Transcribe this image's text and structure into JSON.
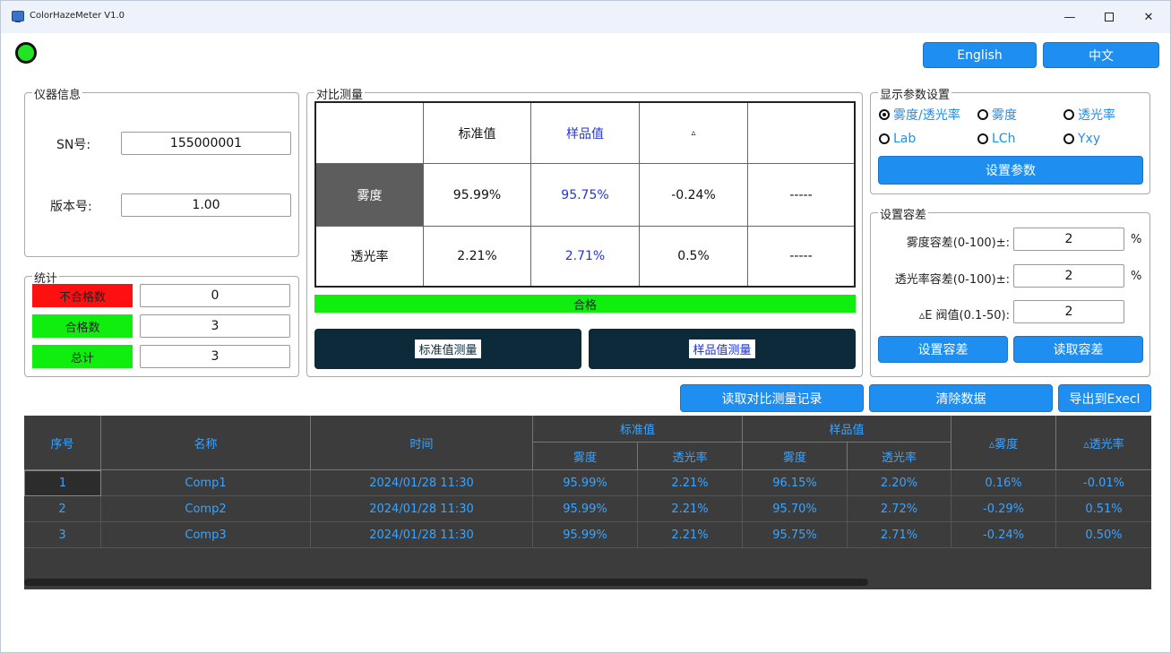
{
  "window": {
    "title": "ColorHazeMeter V1.0",
    "min": "—",
    "close": "✕"
  },
  "lang": {
    "english": "English",
    "chinese": "中文"
  },
  "info": {
    "legend": "仪器信息",
    "sn_label": "SN号:",
    "sn_value": "155000001",
    "version_label": "版本号:",
    "version_value": "1.00"
  },
  "stats": {
    "legend": "统计",
    "fail_label": "不合格数",
    "fail_value": "0",
    "pass_label": "合格数",
    "pass_value": "3",
    "total_label": "总计",
    "total_value": "3"
  },
  "compare": {
    "legend": "对比测量",
    "headers": [
      "",
      "标准值",
      "样品值",
      "▵",
      ""
    ],
    "rows": [
      {
        "label": "雾度",
        "std": "95.99%",
        "sample": "95.75%",
        "delta": "-0.24%",
        "extra": "-----"
      },
      {
        "label": "透光率",
        "std": "2.21%",
        "sample": "2.71%",
        "delta": "0.5%",
        "extra": "-----"
      }
    ],
    "result": "合格",
    "std_btn": "标准值测量",
    "sample_btn": "样品值测量"
  },
  "display": {
    "legend": "显示参数设置",
    "options": [
      "雾度/透光率",
      "雾度",
      "透光率",
      "Lab",
      "LCh",
      "Yxy"
    ],
    "selected_index": 0,
    "set_btn": "设置参数"
  },
  "tolerance": {
    "legend": "设置容差",
    "haze_label": "雾度容差(0-100)±:",
    "haze_value": "2",
    "haze_unit": "%",
    "trans_label": "透光率容差(0-100)±:",
    "trans_value": "2",
    "trans_unit": "%",
    "de_label": "▵E 阀值(0.1-50):",
    "de_value": "2",
    "set_btn": "设置容差",
    "read_btn": "读取容差"
  },
  "actions": {
    "read_records": "读取对比测量记录",
    "clear": "清除数据",
    "export": "导出到Execl"
  },
  "table": {
    "h_index": "序号",
    "h_name": "名称",
    "h_time": "时间",
    "h_std": "标准值",
    "h_sample": "样品值",
    "h_haze": "雾度",
    "h_trans": "透光率",
    "h_dhaze": "▵雾度",
    "h_dtrans": "▵透光率",
    "rows": [
      {
        "idx": "1",
        "name": "Comp1",
        "time": "2024/01/28  11:30",
        "std_haze": "95.99%",
        "std_trans": "2.21%",
        "s_haze": "96.15%",
        "s_trans": "2.20%",
        "d_haze": "0.16%",
        "d_trans": "-0.01%"
      },
      {
        "idx": "2",
        "name": "Comp2",
        "time": "2024/01/28  11:30",
        "std_haze": "95.99%",
        "std_trans": "2.21%",
        "s_haze": "95.70%",
        "s_trans": "2.72%",
        "d_haze": "-0.29%",
        "d_trans": "0.51%"
      },
      {
        "idx": "3",
        "name": "Comp3",
        "time": "2024/01/28  11:30",
        "std_haze": "95.99%",
        "std_trans": "2.21%",
        "s_haze": "95.75%",
        "s_trans": "2.71%",
        "d_haze": "-0.24%",
        "d_trans": "0.50%"
      }
    ]
  }
}
